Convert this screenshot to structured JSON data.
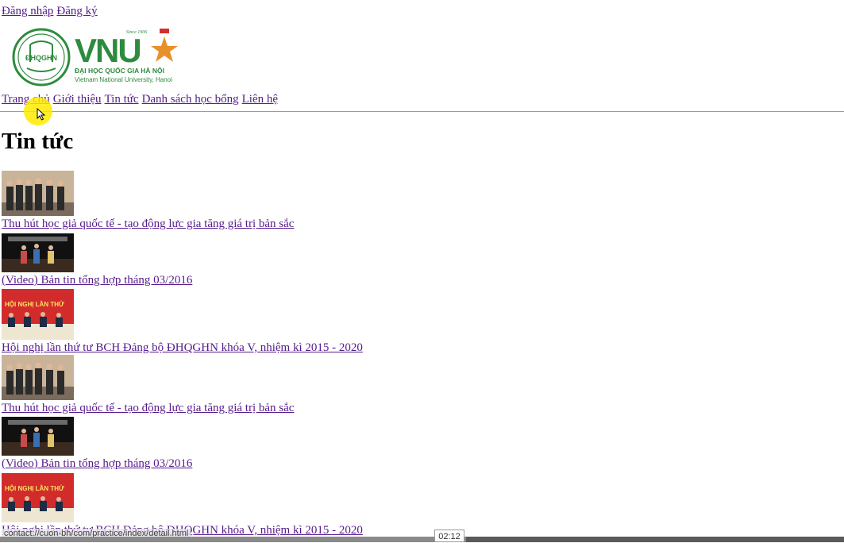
{
  "auth": {
    "login": "Đăng nhập",
    "register": "Đăng ký"
  },
  "logo": {
    "since": "Since 1906",
    "emblem_text": "ĐHQGHN",
    "wordmark": "VNU",
    "name_vi": "ĐẠI HỌC QUỐC GIA HÀ NỘI",
    "name_en": "Vietnam National University, Hanoi",
    "brand_color": "#2e8b3e",
    "star_color": "#e8902a"
  },
  "nav": [
    {
      "label": "Trang chủ"
    },
    {
      "label": "Giới thiệu"
    },
    {
      "label": "Tin tức"
    },
    {
      "label": "Danh sách học bổng"
    },
    {
      "label": "Liên hệ"
    }
  ],
  "page_title": "Tin tức",
  "news": [
    {
      "title": "Thu hút học giả quốc tế - tạo động lực gia tăng giá trị bản sắc",
      "thumb": "group-photo"
    },
    {
      "title": "(Video) Bản tin tổng hợp tháng 03/2016",
      "thumb": "video-stage"
    },
    {
      "title": "Hội nghị lần thứ tư BCH Đảng bộ ĐHQGHN khóa V, nhiệm kì 2015 - 2020",
      "thumb": "conference-red",
      "banner": "HỘI NGHỊ LẦN THỨ"
    },
    {
      "title": "Thu hút học giả quốc tế - tạo động lực gia tăng giá trị bản sắc",
      "thumb": "group-photo"
    },
    {
      "title": "(Video) Bản tin tổng hợp tháng 03/2016",
      "thumb": "video-stage"
    },
    {
      "title": "Hội nghị lần thứ tư BCH Đảng bộ ĐHQGHN khóa V, nhiệm kì 2015 - 2020",
      "thumb": "conference-red",
      "banner": "HỘI NGHỊ LẦN THỨ"
    }
  ],
  "status_bar": {
    "url": "contact://cuon-bh/com/practice/index/detail.html"
  },
  "video": {
    "timecode": "02:12"
  }
}
